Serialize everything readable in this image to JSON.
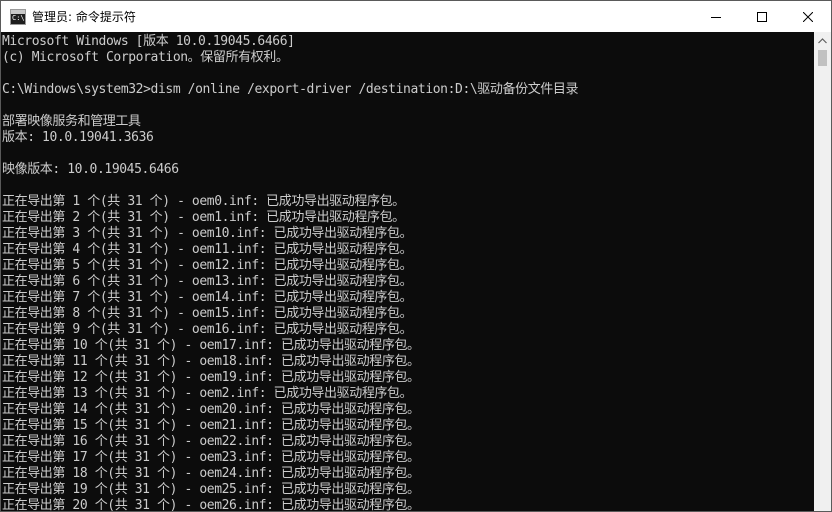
{
  "window": {
    "title": "管理员: 命令提示符",
    "icon_text": "C:\\"
  },
  "console": {
    "lines": [
      "Microsoft Windows [版本 10.0.19045.6466]",
      "(c) Microsoft Corporation。保留所有权利。",
      "",
      "C:\\Windows\\system32>dism /online /export-driver /destination:D:\\驱动备份文件目录",
      "",
      "部署映像服务和管理工具",
      "版本: 10.0.19041.3636",
      "",
      "映像版本: 10.0.19045.6466",
      "",
      "正在导出第 1 个(共 31 个) - oem0.inf: 已成功导出驱动程序包。",
      "正在导出第 2 个(共 31 个) - oem1.inf: 已成功导出驱动程序包。",
      "正在导出第 3 个(共 31 个) - oem10.inf: 已成功导出驱动程序包。",
      "正在导出第 4 个(共 31 个) - oem11.inf: 已成功导出驱动程序包。",
      "正在导出第 5 个(共 31 个) - oem12.inf: 已成功导出驱动程序包。",
      "正在导出第 6 个(共 31 个) - oem13.inf: 已成功导出驱动程序包。",
      "正在导出第 7 个(共 31 个) - oem14.inf: 已成功导出驱动程序包。",
      "正在导出第 8 个(共 31 个) - oem15.inf: 已成功导出驱动程序包。",
      "正在导出第 9 个(共 31 个) - oem16.inf: 已成功导出驱动程序包。",
      "正在导出第 10 个(共 31 个) - oem17.inf: 已成功导出驱动程序包。",
      "正在导出第 11 个(共 31 个) - oem18.inf: 已成功导出驱动程序包。",
      "正在导出第 12 个(共 31 个) - oem19.inf: 已成功导出驱动程序包。",
      "正在导出第 13 个(共 31 个) - oem2.inf: 已成功导出驱动程序包。",
      "正在导出第 14 个(共 31 个) - oem20.inf: 已成功导出驱动程序包。",
      "正在导出第 15 个(共 31 个) - oem21.inf: 已成功导出驱动程序包。",
      "正在导出第 16 个(共 31 个) - oem22.inf: 已成功导出驱动程序包。",
      "正在导出第 17 个(共 31 个) - oem23.inf: 已成功导出驱动程序包。",
      "正在导出第 18 个(共 31 个) - oem24.inf: 已成功导出驱动程序包。",
      "正在导出第 19 个(共 31 个) - oem25.inf: 已成功导出驱动程序包。",
      "正在导出第 20 个(共 31 个) - oem26.inf: 已成功导出驱动程序包。"
    ]
  },
  "icons": {
    "app": "cmd-app-icon",
    "minimize": "minimize-icon",
    "maximize": "maximize-icon",
    "close": "close-icon",
    "scroll_up": "scroll-up-arrow-icon"
  },
  "colors": {
    "console_background": "#0c0c0c",
    "console_text": "#cccccc",
    "titlebar_background": "#ffffff",
    "scrollbar_track": "#f0f0f0",
    "scrollbar_thumb": "#c1c1c1"
  }
}
